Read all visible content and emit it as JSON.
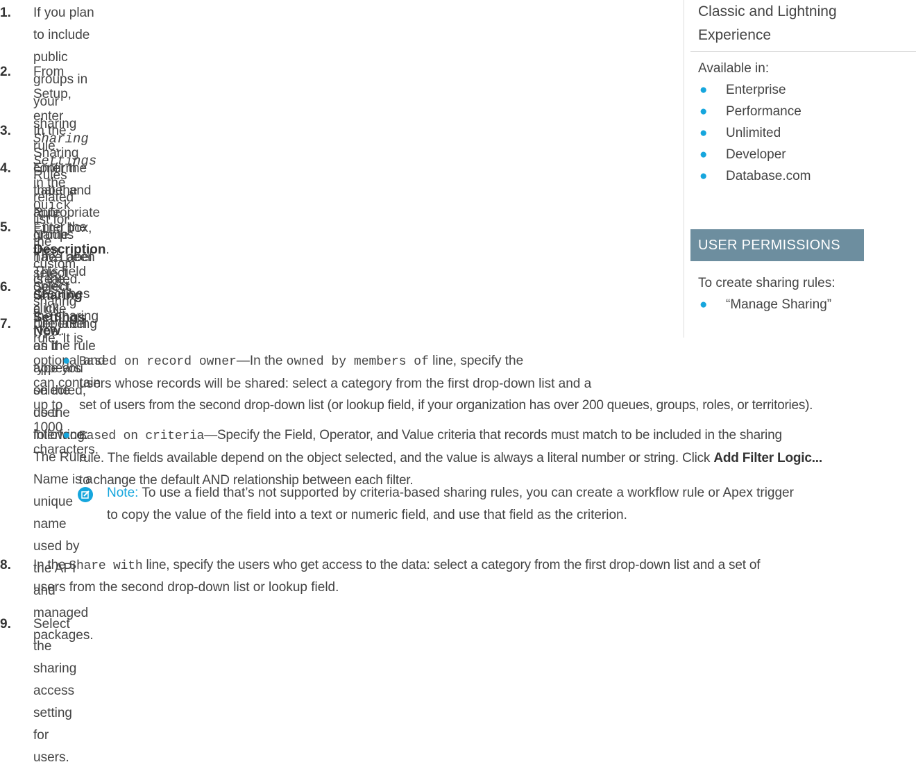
{
  "steps": [
    {
      "num": "1.",
      "line1": "If you plan to include public groups in your sharing rule, confirm that the appropriate groups",
      "line2": "have been created."
    },
    {
      "num": "2.",
      "p1": "From Setup, enter ",
      "code1": "Sharing Settings",
      "p2": " in the ",
      "code2": "Quick Find",
      "p3": " box, then select ",
      "b1": "Sharing",
      "b2": "Settings",
      "p4": "."
    },
    {
      "num": "3.",
      "p1": "In the Sharing Rules related list for the custom object, click ",
      "b1": "New",
      "p2": "."
    },
    {
      "num": "4.",
      "line1": "Enter the Label and Rule Name. The Label is the sharing rule label as it appears on the user",
      "line2": "interface. The Rule Name is a unique name used by the API and managed packages."
    },
    {
      "num": "5.",
      "p1": "Enter the ",
      "b1": "Description",
      "p2": ". This field describes the sharing rule. It is optional and can contain up to",
      "line2": "1000 characters."
    },
    {
      "num": "6.",
      "line1": "Select a rule type."
    },
    {
      "num": "7.",
      "line1": "Depending on the rule type you selected, do the following:"
    },
    {
      "num": "8.",
      "p1": "In the ",
      "code1": "Share with",
      "p2": " line, specify the users who get access to the data: select a category from the first drop-down list and a set of",
      "line2": "users from the second drop-down list or lookup field."
    },
    {
      "num": "9.",
      "line1": "Select the sharing access setting for users."
    }
  ],
  "bullets": [
    {
      "code1": "Based on record owner",
      "p1": "—In the ",
      "code2": "owned by members of",
      "p2": " line, specify the",
      "line2": "users whose records will be shared: select a category from the first drop-down list and a",
      "line3": "set of users from the second drop-down list (or lookup field, if your organization has over 200 queues, groups, roles, or territories)."
    },
    {
      "code1": "Based on criteria",
      "p1": "—Specify the Field, Operator, and Value criteria that records must match to be included in the sharing",
      "line2": "rule. The fields available depend on the object selected, and the value is always a literal number or string. Click ",
      "b1": "Add Filter Logic...",
      "line3": "to change the default AND relationship between each filter."
    }
  ],
  "note": {
    "label": "Note:",
    "line1": " To use a field that’s not supported by criteria-based sharing rules, you can create a workflow rule or Apex trigger",
    "line2": "to copy the value of the field into a text or numeric field, and use that field as the criterion."
  },
  "sidebar": {
    "edition_line1": "Classic and Lightning",
    "edition_line2": "Experience",
    "available_label": "Available in:",
    "editions": [
      "Enterprise",
      "Performance",
      "Unlimited",
      "Developer",
      "Database.com"
    ],
    "permissions_header": "USER PERMISSIONS",
    "permission_label": "To create sharing rules:",
    "permissions": [
      "“Manage Sharing”"
    ]
  },
  "colors": {
    "accent": "#16a6dd",
    "badge": "#6d8e9f",
    "text": "#444444"
  },
  "icons": {
    "bullet": "bullet-dot-icon",
    "note": "edit-note-icon"
  }
}
